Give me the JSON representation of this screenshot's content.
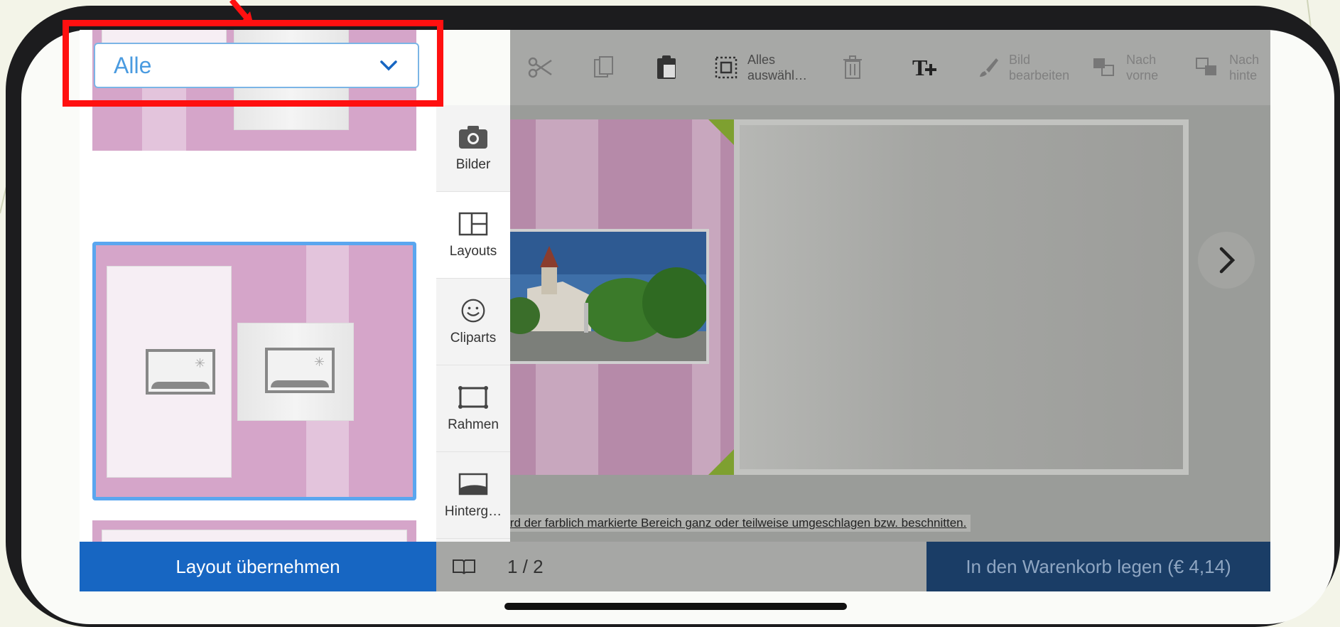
{
  "layout_dropdown": {
    "value": "Alle"
  },
  "left_panel": {
    "apply_button": "Layout übernehmen"
  },
  "side_tools": [
    {
      "label": "Bilder",
      "icon": "camera-icon"
    },
    {
      "label": "Layouts",
      "icon": "layout-icon"
    },
    {
      "label": "Cliparts",
      "icon": "smiley-icon"
    },
    {
      "label": "Rahmen",
      "icon": "frame-icon"
    },
    {
      "label": "Hinterg…",
      "icon": "background-icon"
    }
  ],
  "toolbar": {
    "select_all": "Alles\nauswähl…",
    "edit_image": "Bild\nbearbeiten",
    "bring_forward": "Nach\nvorne",
    "send_back": "Nach\nhinte"
  },
  "editor": {
    "hint": "ird der farblich markierte Bereich ganz oder teilweise umgeschlagen bzw. beschnitten."
  },
  "bottom_bar": {
    "page_counter": "1 / 2",
    "cart_button": "In den Warenkorb legen (€ 4,14)"
  },
  "colors": {
    "accent": "#1766c2",
    "annotation": "#ff1010",
    "layout_pink": "#d5a5c9"
  }
}
